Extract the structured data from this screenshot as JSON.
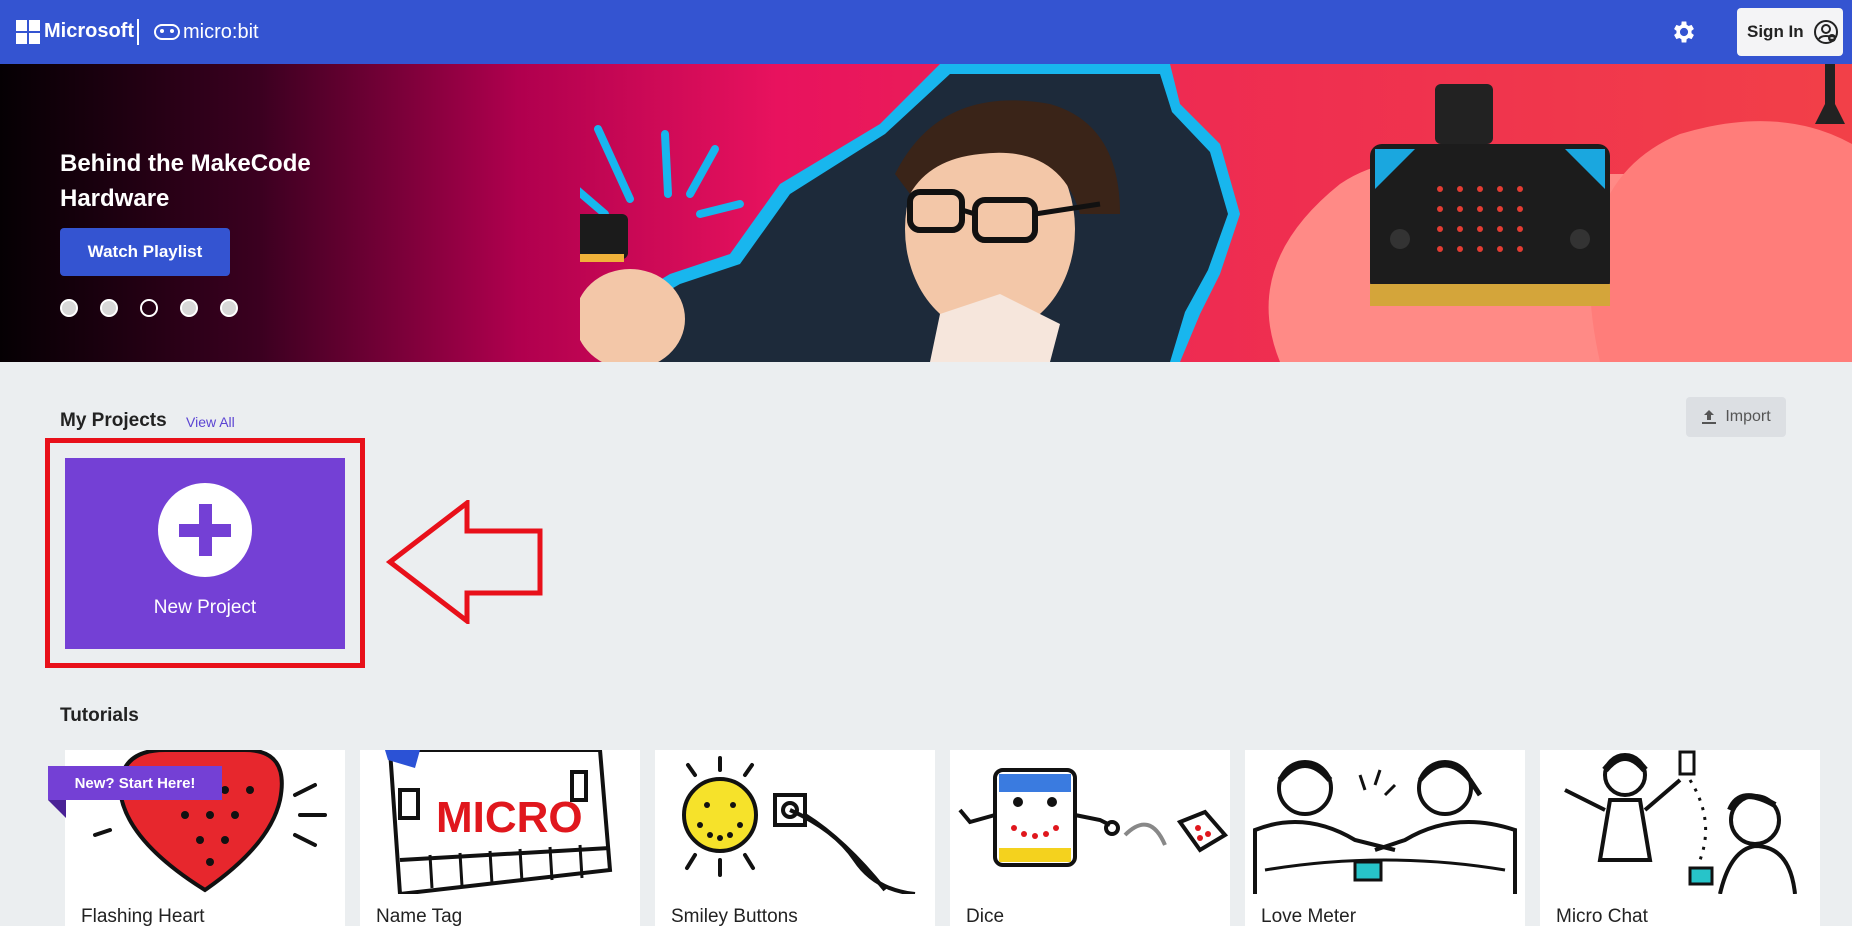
{
  "header": {
    "brand": "Microsoft",
    "product": "micro:bit",
    "settings_icon": "gear-icon",
    "signin_label": "Sign In",
    "signin_icon": "user-circle-icon",
    "accent_color": "#3454d1"
  },
  "hero": {
    "title": "Behind the MakeCode Hardware",
    "button_label": "Watch Playlist",
    "slide_count": 5,
    "active_slide": 3
  },
  "projects": {
    "title": "My Projects",
    "view_all": "View All",
    "import_label": "Import",
    "import_icon": "upload-icon",
    "new_project_label": "New Project",
    "new_project_color": "#7440d5",
    "annotation_color": "#e8101a"
  },
  "tutorials": {
    "title": "Tutorials",
    "badge": "New? Start Here!",
    "items": [
      {
        "label": "Flashing Heart"
      },
      {
        "label": "Name Tag",
        "art_text": "MICRO"
      },
      {
        "label": "Smiley Buttons"
      },
      {
        "label": "Dice"
      },
      {
        "label": "Love Meter"
      },
      {
        "label": "Micro Chat"
      }
    ]
  }
}
